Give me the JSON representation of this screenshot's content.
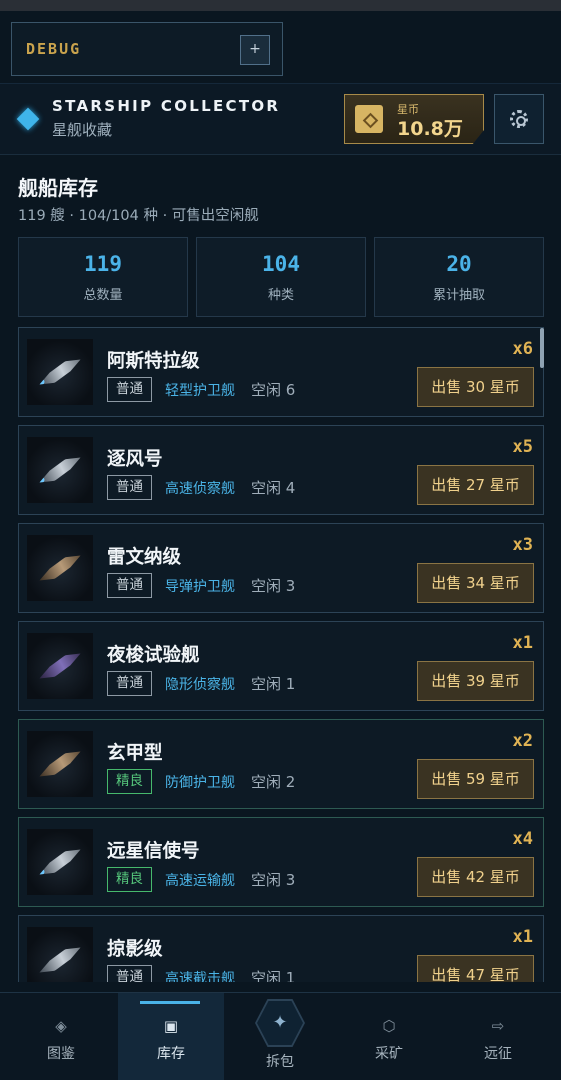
{
  "debug": {
    "label": "DEBUG",
    "plus": "+"
  },
  "header": {
    "title": "STARSHIP COLLECTOR",
    "subtitle": "星舰收藏",
    "currency_label": "星币",
    "currency_value": "10.8万",
    "settings_icon": "gear-icon"
  },
  "section": {
    "title": "舰船库存",
    "summary": "119 艘 · 104/104 种 · 可售出空闲舰"
  },
  "stats": [
    {
      "value": "119",
      "label": "总数量"
    },
    {
      "value": "104",
      "label": "种类"
    },
    {
      "value": "20",
      "label": "累计抽取"
    }
  ],
  "ships": [
    {
      "name": "阿斯特拉级",
      "rarity": "普通",
      "class": "轻型护卫舰",
      "idle": "空闲 6",
      "count": "x6",
      "sell": "出售 30 星币"
    },
    {
      "name": "逐风号",
      "rarity": "普通",
      "class": "高速侦察舰",
      "idle": "空闲 4",
      "count": "x5",
      "sell": "出售 27 星币"
    },
    {
      "name": "雷文纳级",
      "rarity": "普通",
      "class": "导弹护卫舰",
      "idle": "空闲 3",
      "count": "x3",
      "sell": "出售 34 星币"
    },
    {
      "name": "夜梭试验舰",
      "rarity": "普通",
      "class": "隐形侦察舰",
      "idle": "空闲 1",
      "count": "x1",
      "sell": "出售 39 星币"
    },
    {
      "name": "玄甲型",
      "rarity": "精良",
      "class": "防御护卫舰",
      "idle": "空闲 2",
      "count": "x2",
      "sell": "出售 59 星币"
    },
    {
      "name": "远星信使号",
      "rarity": "精良",
      "class": "高速运输舰",
      "idle": "空闲 3",
      "count": "x4",
      "sell": "出售 42 星币"
    },
    {
      "name": "掠影级",
      "rarity": "普通",
      "class": "高速截击舰",
      "idle": "空闲 1",
      "count": "x1",
      "sell": "出售 47 星币"
    }
  ],
  "nav": [
    {
      "label": "图鉴",
      "icon": "◈"
    },
    {
      "label": "库存",
      "icon": "▣"
    },
    {
      "label": "拆包",
      "icon": "✦"
    },
    {
      "label": "采矿",
      "icon": "⬡"
    },
    {
      "label": "远征",
      "icon": "⇨"
    }
  ],
  "colors": {
    "accent": "#4ab3e8",
    "gold": "#e0b354",
    "fine": "#56c77c"
  }
}
